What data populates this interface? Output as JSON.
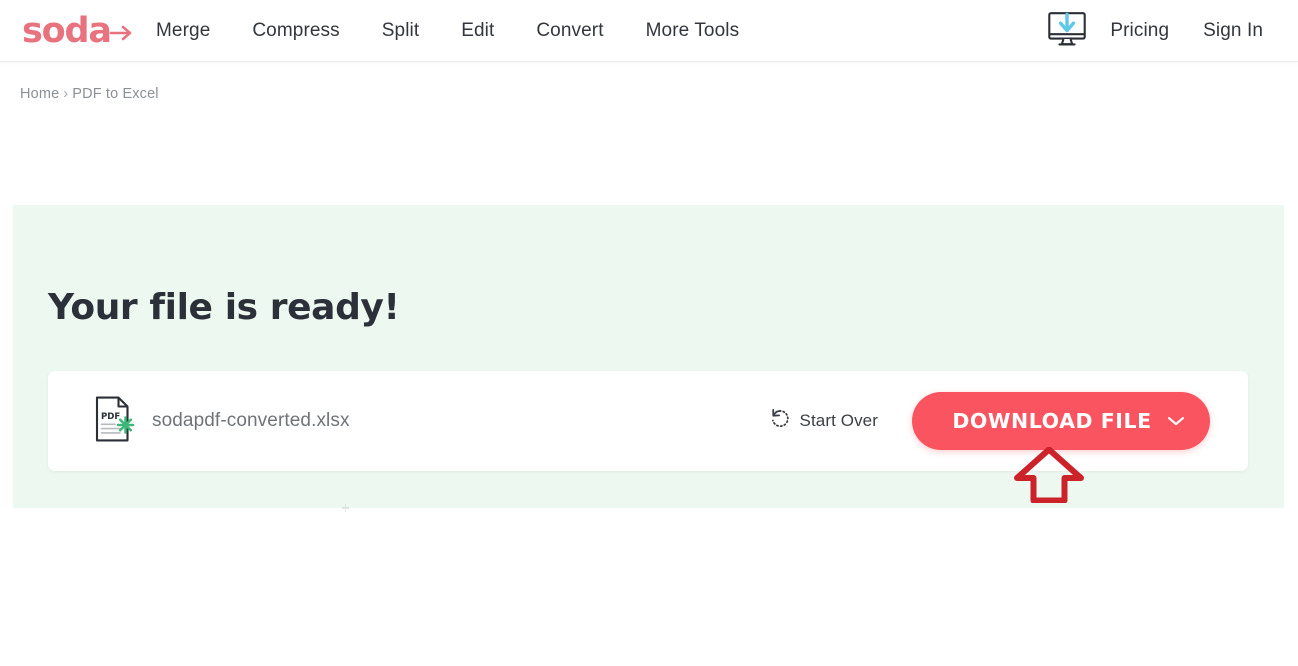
{
  "header": {
    "logo": {
      "text": "soda",
      "icon": "arrow-right-icon",
      "color": "#e8737f"
    },
    "nav_items": [
      {
        "label": "Merge",
        "name": "nav-link-merge"
      },
      {
        "label": "Compress",
        "name": "nav-link-compress"
      },
      {
        "label": "Split",
        "name": "nav-link-split"
      },
      {
        "label": "Edit",
        "name": "nav-link-edit"
      },
      {
        "label": "Convert",
        "name": "nav-link-convert"
      },
      {
        "label": "More Tools",
        "name": "nav-link-more-tools"
      }
    ],
    "desktop_app_icon": "desktop-download-icon",
    "pricing_label": "Pricing",
    "signin_label": "Sign In"
  },
  "breadcrumb": {
    "home_label": "Home",
    "separator": "›",
    "current_label": "PDF to Excel"
  },
  "result": {
    "title": "Your file is ready!",
    "panel_color": "#edf9f0",
    "file": {
      "name": "sodapdf-converted.xlsx",
      "icon": "pdf-file-icon",
      "badge_icon": "sparkle-icon",
      "badge_color": "#3cb878"
    },
    "start_over": {
      "label": "Start Over",
      "icon": "undo-rotate-icon"
    },
    "download": {
      "label": "DOWNLOAD FILE",
      "caret_icon": "chevron-down-icon",
      "color": "#f9545f"
    }
  },
  "annotation": {
    "arrow_icon": "arrow-up-outline-icon",
    "color": "#cc2229"
  }
}
